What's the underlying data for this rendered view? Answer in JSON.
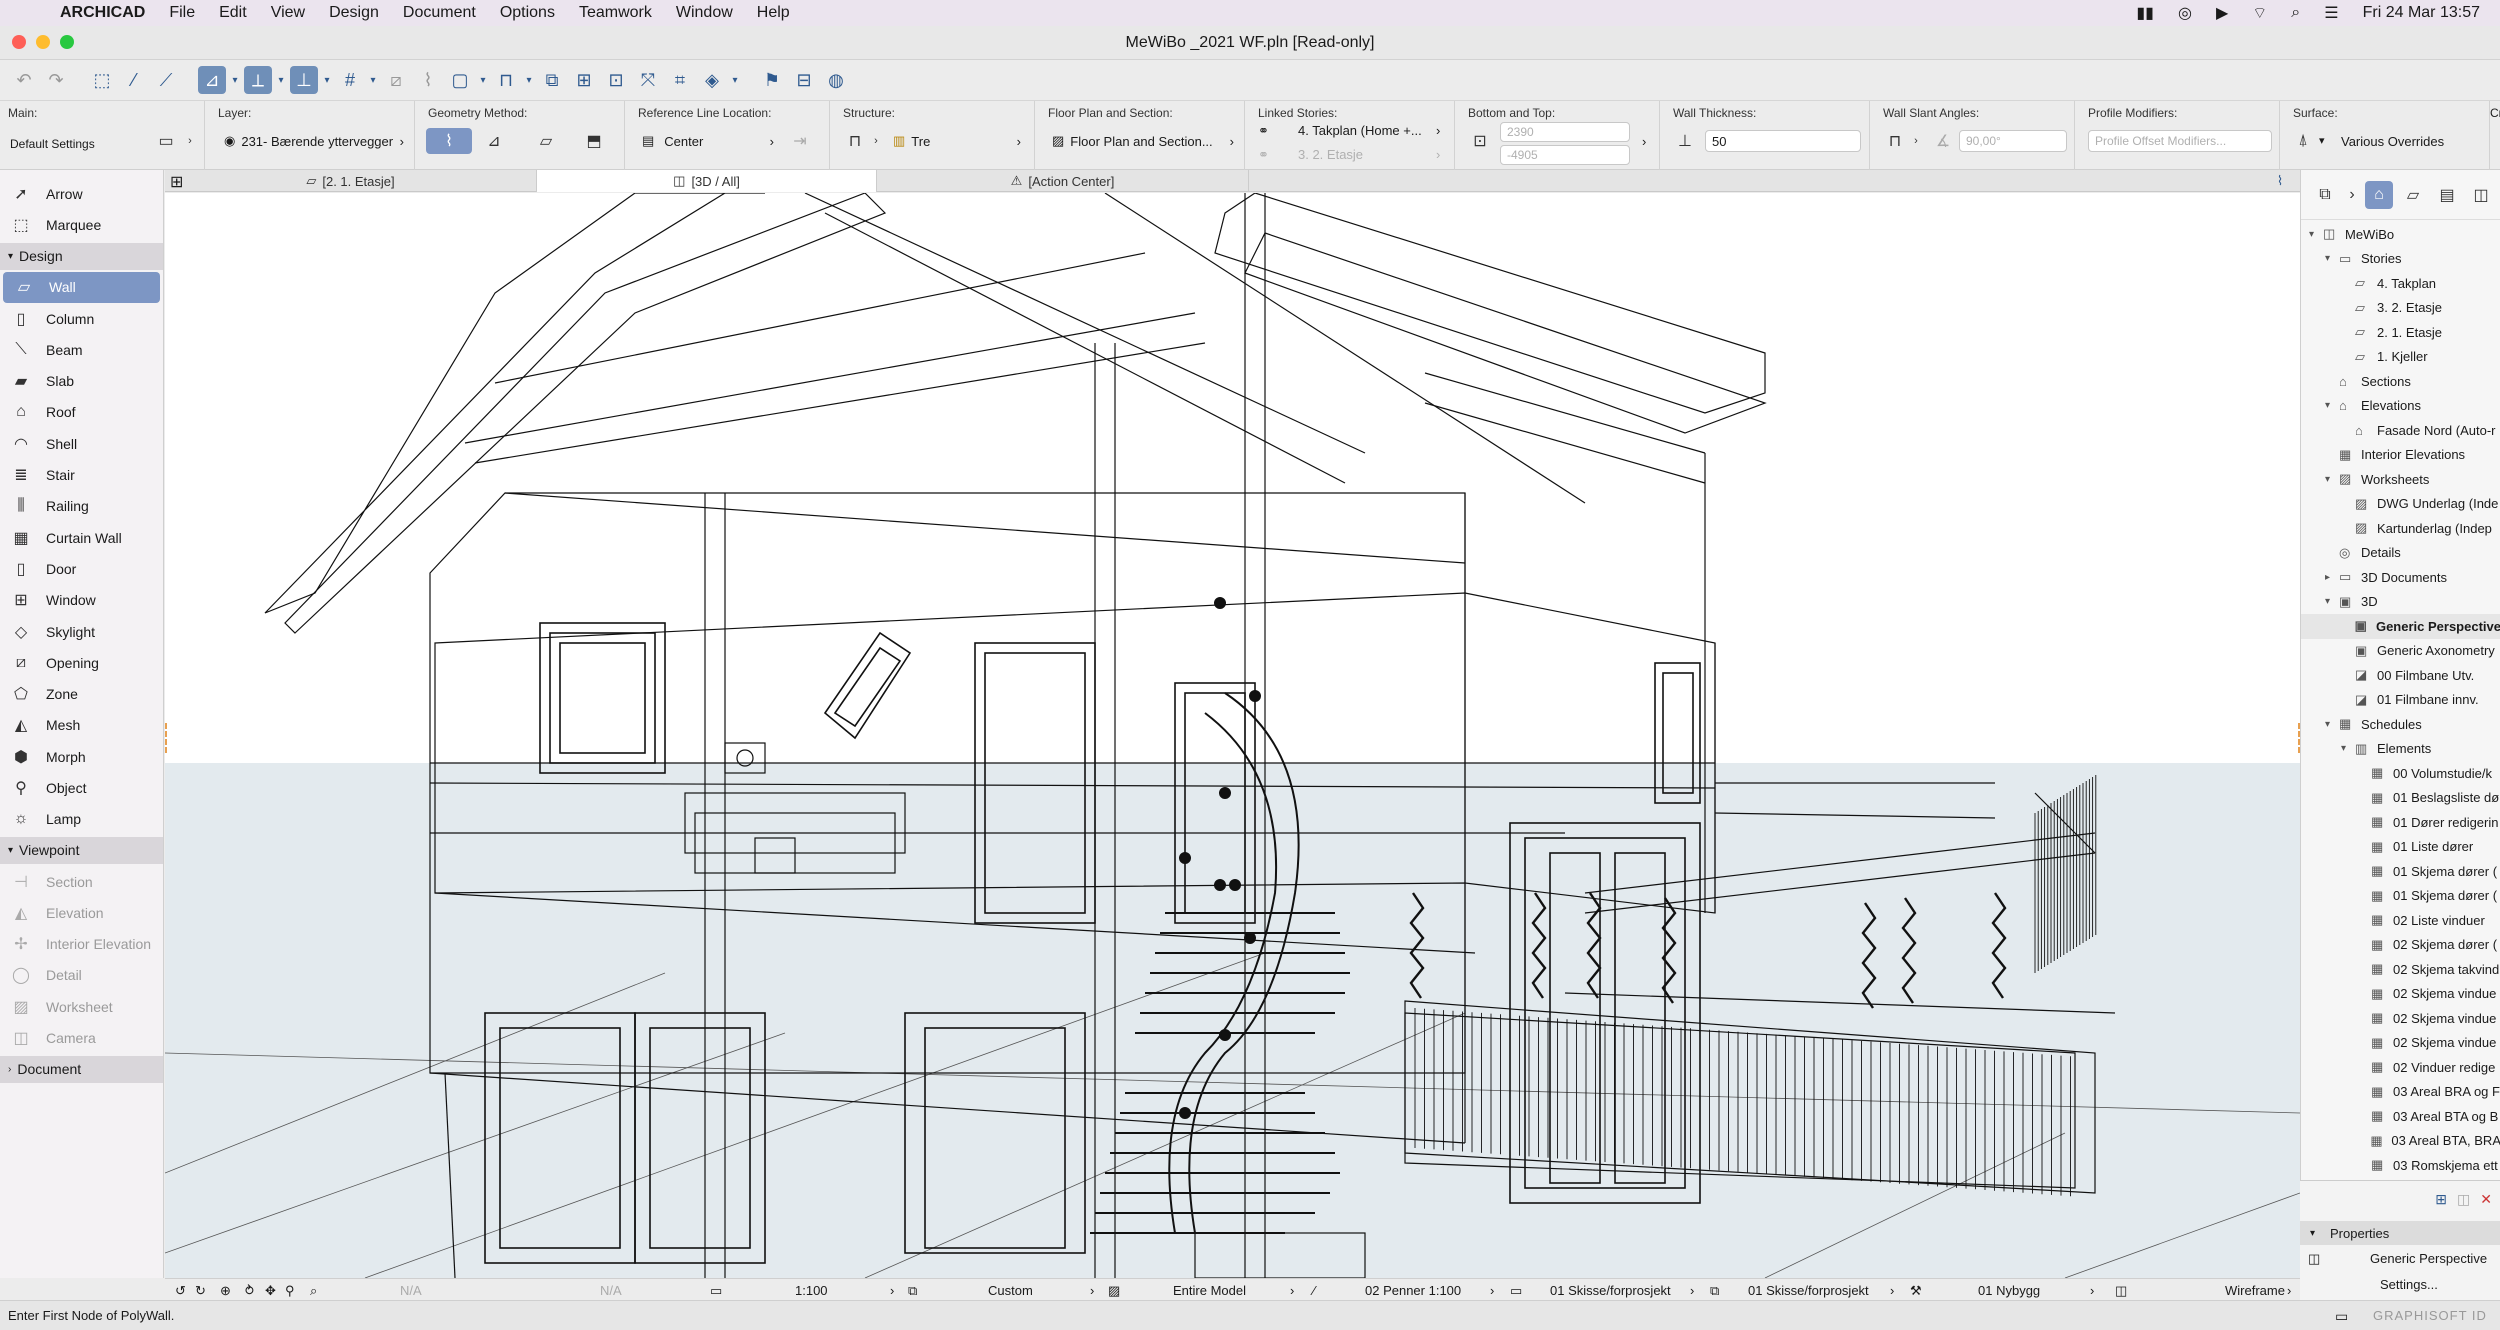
{
  "menubar": {
    "app": "ARCHICAD",
    "items": [
      "File",
      "Edit",
      "View",
      "Design",
      "Document",
      "Options",
      "Teamwork",
      "Window",
      "Help"
    ],
    "clock": "Fri 24 Mar  13:57"
  },
  "window": {
    "title": "MeWiBo _2021 WF.pln [Read-only]"
  },
  "infobox": {
    "main_label": "Main:",
    "main_value": "Default Settings",
    "layer_label": "Layer:",
    "layer_value": "231- Bærende yttervegger",
    "geometry_label": "Geometry Method:",
    "refline_label": "Reference Line Location:",
    "refline_value": "Center",
    "structure_label": "Structure:",
    "structure_value": "Tre",
    "fps_label": "Floor Plan and Section:",
    "fps_value": "Floor Plan and Section...",
    "linked_label": "Linked Stories:",
    "linked_top": "4. Takplan (Home +...",
    "linked_bottom": "3. 2. Etasje",
    "bt_label": "Bottom and Top:",
    "bt_top": "2390",
    "bt_bottom": "-4905",
    "thickness_label": "Wall Thickness:",
    "thickness_value": "50",
    "slant_label": "Wall Slant Angles:",
    "slant_value": "90,00°",
    "profile_label": "Profile Modifiers:",
    "profile_value": "Profile Offset Modifiers...",
    "surface_label": "Surface:",
    "surface_value": "Various Overrides",
    "cr_label": "Cr"
  },
  "tabs": [
    {
      "label": "[2. 1. Etasje]"
    },
    {
      "label": "[3D / All]"
    },
    {
      "label": "[Action Center]"
    }
  ],
  "toolbox": {
    "top_tools": [
      {
        "label": "Arrow",
        "icon": "arrow-icon"
      },
      {
        "label": "Marquee",
        "icon": "marquee-icon"
      }
    ],
    "design_header": "Design",
    "design_tools": [
      {
        "label": "Wall",
        "icon": "wall-icon"
      },
      {
        "label": "Column",
        "icon": "column-icon"
      },
      {
        "label": "Beam",
        "icon": "beam-icon"
      },
      {
        "label": "Slab",
        "icon": "slab-icon"
      },
      {
        "label": "Roof",
        "icon": "roof-icon"
      },
      {
        "label": "Shell",
        "icon": "shell-icon"
      },
      {
        "label": "Stair",
        "icon": "stair-icon"
      },
      {
        "label": "Railing",
        "icon": "railing-icon"
      },
      {
        "label": "Curtain Wall",
        "icon": "curtain-wall-icon"
      },
      {
        "label": "Door",
        "icon": "door-icon"
      },
      {
        "label": "Window",
        "icon": "window-icon"
      },
      {
        "label": "Skylight",
        "icon": "skylight-icon"
      },
      {
        "label": "Opening",
        "icon": "opening-icon"
      },
      {
        "label": "Zone",
        "icon": "zone-icon"
      },
      {
        "label": "Mesh",
        "icon": "mesh-icon"
      },
      {
        "label": "Morph",
        "icon": "morph-icon"
      },
      {
        "label": "Object",
        "icon": "object-icon"
      },
      {
        "label": "Lamp",
        "icon": "lamp-icon"
      }
    ],
    "viewpoint_header": "Viewpoint",
    "viewpoint_tools": [
      {
        "label": "Section",
        "icon": "section-icon"
      },
      {
        "label": "Elevation",
        "icon": "elevation-icon"
      },
      {
        "label": "Interior Elevation",
        "icon": "interior-elevation-icon"
      },
      {
        "label": "Detail",
        "icon": "detail-icon"
      },
      {
        "label": "Worksheet",
        "icon": "worksheet-icon"
      },
      {
        "label": "Camera",
        "icon": "camera-icon"
      }
    ],
    "document_header": "Document"
  },
  "navigator": {
    "tree": [
      {
        "label": "MeWiBo",
        "level": 0,
        "arrow": "▾",
        "icon": "◫"
      },
      {
        "label": "Stories",
        "level": 1,
        "arrow": "▾",
        "icon": "▭"
      },
      {
        "label": "4. Takplan",
        "level": 2,
        "arrow": "",
        "icon": "▱"
      },
      {
        "label": "3. 2. Etasje",
        "level": 2,
        "arrow": "",
        "icon": "▱"
      },
      {
        "label": "2. 1. Etasje",
        "level": 2,
        "arrow": "",
        "icon": "▱"
      },
      {
        "label": "1. Kjeller",
        "level": 2,
        "arrow": "",
        "icon": "▱"
      },
      {
        "label": "Sections",
        "level": 1,
        "arrow": "",
        "icon": "⌂"
      },
      {
        "label": "Elevations",
        "level": 1,
        "arrow": "▾",
        "icon": "⌂"
      },
      {
        "label": "Fasade Nord (Auto-r",
        "level": 2,
        "arrow": "",
        "icon": "⌂"
      },
      {
        "label": "Interior Elevations",
        "level": 1,
        "arrow": "",
        "icon": "▦"
      },
      {
        "label": "Worksheets",
        "level": 1,
        "arrow": "▾",
        "icon": "▨"
      },
      {
        "label": "DWG Underlag (Inde",
        "level": 2,
        "arrow": "",
        "icon": "▨"
      },
      {
        "label": "Kartunderlag (Indep",
        "level": 2,
        "arrow": "",
        "icon": "▨"
      },
      {
        "label": "Details",
        "level": 1,
        "arrow": "",
        "icon": "◎"
      },
      {
        "label": "3D Documents",
        "level": 1,
        "arrow": "▸",
        "icon": "▭"
      },
      {
        "label": "3D",
        "level": 1,
        "arrow": "▾",
        "icon": "▣"
      },
      {
        "label": "Generic Perspective",
        "level": 2,
        "arrow": "",
        "icon": "▣",
        "selected": true
      },
      {
        "label": "Generic Axonometry",
        "level": 2,
        "arrow": "",
        "icon": "▣"
      },
      {
        "label": "00 Filmbane Utv.",
        "level": 2,
        "arrow": "",
        "icon": "◪"
      },
      {
        "label": "01 Filmbane innv.",
        "level": 2,
        "arrow": "",
        "icon": "◪"
      },
      {
        "label": "Schedules",
        "level": 1,
        "arrow": "▾",
        "icon": "▦"
      },
      {
        "label": "Elements",
        "level": 2,
        "arrow": "▾",
        "icon": "▥"
      },
      {
        "label": "00 Volumstudie/k",
        "level": 3,
        "arrow": "",
        "icon": "▦"
      },
      {
        "label": "01 Beslagsliste dø",
        "level": 3,
        "arrow": "",
        "icon": "▦"
      },
      {
        "label": "01 Dører redigerin",
        "level": 3,
        "arrow": "",
        "icon": "▦"
      },
      {
        "label": "01 Liste dører",
        "level": 3,
        "arrow": "",
        "icon": "▦"
      },
      {
        "label": "01 Skjema dører (",
        "level": 3,
        "arrow": "",
        "icon": "▦"
      },
      {
        "label": "01 Skjema dører (",
        "level": 3,
        "arrow": "",
        "icon": "▦"
      },
      {
        "label": "02 Liste vinduer",
        "level": 3,
        "arrow": "",
        "icon": "▦"
      },
      {
        "label": "02 Skjema dører (",
        "level": 3,
        "arrow": "",
        "icon": "▦"
      },
      {
        "label": "02 Skjema takvind",
        "level": 3,
        "arrow": "",
        "icon": "▦"
      },
      {
        "label": "02 Skjema vindue",
        "level": 3,
        "arrow": "",
        "icon": "▦"
      },
      {
        "label": "02 Skjema vindue",
        "level": 3,
        "arrow": "",
        "icon": "▦"
      },
      {
        "label": "02 Skjema vindue",
        "level": 3,
        "arrow": "",
        "icon": "▦"
      },
      {
        "label": "02 Vinduer redige",
        "level": 3,
        "arrow": "",
        "icon": "▦"
      },
      {
        "label": "03 Areal BRA og F",
        "level": 3,
        "arrow": "",
        "icon": "▦"
      },
      {
        "label": "03 Areal BTA og B",
        "level": 3,
        "arrow": "",
        "icon": "▦"
      },
      {
        "label": "03 Areal BTA, BRA",
        "level": 3,
        "arrow": "",
        "icon": "▦"
      },
      {
        "label": "03 Romskjema ett",
        "level": 3,
        "arrow": "",
        "icon": "▦"
      }
    ]
  },
  "properties": {
    "header": "Properties",
    "view_name": "Generic Perspective",
    "settings_button": "Settings...",
    "brand": "GRAPHISOFT ID"
  },
  "statusbar": {
    "na1": "N/A",
    "na2": "N/A",
    "scale": "1:100",
    "custom": "Custom",
    "model": "Entire Model",
    "pens": "02 Penner 1:100",
    "mvo1": "01 Skisse/forprosjekt",
    "mvo2": "01 Skisse/forprosjekt",
    "reno": "01 Nybygg",
    "mode": "Wireframe"
  },
  "message": "Enter First Node of PolyWall.",
  "colors": {
    "accent": "#7d96c4",
    "selected_tool": "#7d96c4"
  }
}
